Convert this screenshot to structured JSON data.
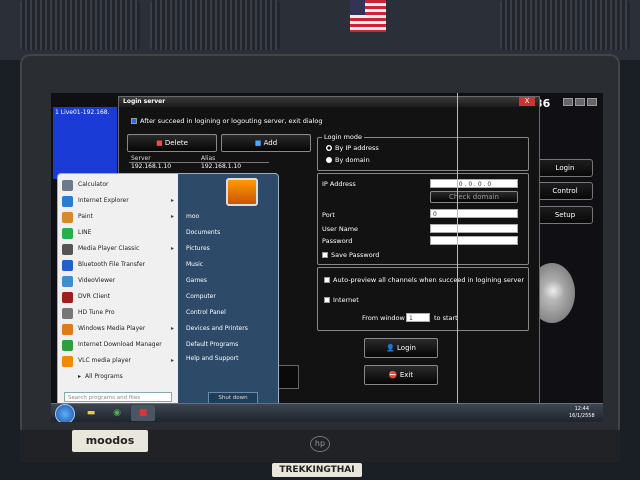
{
  "environment": {
    "monitor_brand": "hp",
    "sticker_left": "moodos",
    "sticker_bottom": "TREKKINGTHAI"
  },
  "status_panel": {
    "line1": "1 Live01-192.168."
  },
  "clock": "36",
  "side_buttons": [
    "Login",
    "Control",
    "Setup"
  ],
  "dialog": {
    "title": "Login server",
    "close_label": "X",
    "exit_after_label": "After succeed in logining or logouting server, exit dialog",
    "delete_label": "Delete",
    "add_label": "Add",
    "table": {
      "headers": [
        "Server",
        "Alias"
      ],
      "rows": [
        {
          "server": "192.168.1.10",
          "alias": "192.168.1.10"
        }
      ]
    },
    "login_mode": {
      "title": "Login mode",
      "by_ip": "By IP address",
      "by_domain": "By domain"
    },
    "ip_label": "IP Address",
    "ip_value": "0 . 0 . 0 . 0",
    "check_domain": "Check domain",
    "port_label": "Port",
    "port_value": "0",
    "username_label": "User Name",
    "password_label": "Password",
    "save_password": "Save Password",
    "auto_preview": "Auto-preview all channels when succeed in logining server",
    "internet": "Internet",
    "from_window": "From window",
    "from_window_value": "1",
    "to_start": "to start",
    "login_button": "Login",
    "exit_button": "Exit"
  },
  "startmenu": {
    "left_items": [
      {
        "label": "Calculator",
        "icon": "calculator-icon",
        "color": "#6c7a89",
        "arrow": false
      },
      {
        "label": "Internet Explorer",
        "icon": "ie-icon",
        "color": "#2a7bd4",
        "arrow": true
      },
      {
        "label": "Paint",
        "icon": "paint-icon",
        "color": "#d88a2a",
        "arrow": true
      },
      {
        "label": "LINE",
        "icon": "line-icon",
        "color": "#22b14c",
        "arrow": false
      },
      {
        "label": "Media Player Classic",
        "icon": "mpc-icon",
        "color": "#555",
        "arrow": true
      },
      {
        "label": "Bluetooth File Transfer",
        "icon": "bluetooth-icon",
        "color": "#1f5fd0",
        "arrow": false
      },
      {
        "label": "VideoViewer",
        "icon": "videoviewer-icon",
        "color": "#3e8ed0",
        "arrow": false
      },
      {
        "label": "DVR Client",
        "icon": "dvr-icon",
        "color": "#a02020",
        "arrow": false
      },
      {
        "label": "HD Tune Pro",
        "icon": "hdtune-icon",
        "color": "#777",
        "arrow": false
      },
      {
        "label": "Windows Media Player",
        "icon": "wmp-icon",
        "color": "#e07b1a",
        "arrow": true
      },
      {
        "label": "Internet Download Manager",
        "icon": "idm-icon",
        "color": "#2e9e3e",
        "arrow": false
      },
      {
        "label": "VLC media player",
        "icon": "vlc-icon",
        "color": "#f08a00",
        "arrow": true
      }
    ],
    "all_programs": "All Programs",
    "search_placeholder": "Search programs and files",
    "right_items": [
      "moo",
      "Documents",
      "Pictures",
      "Music",
      "Games",
      "Computer",
      "Control Panel",
      "Devices and Printers",
      "Default Programs",
      "Help and Support"
    ],
    "shutdown": "Shut down"
  },
  "taskbar": {
    "time": "12:44",
    "date": "16/1/2558"
  }
}
